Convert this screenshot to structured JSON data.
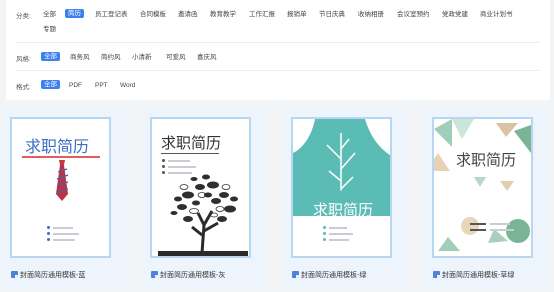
{
  "filters": {
    "category": {
      "label": "分类:",
      "options": [
        "全部",
        "简历",
        "员工登记表",
        "合同模板",
        "邀请函",
        "教育教学",
        "工作汇报",
        "报销单",
        "节日庆典",
        "收纳相册",
        "会议室预约",
        "党政党建",
        "商业计划书",
        "专题"
      ],
      "active": "简历"
    },
    "style": {
      "label": "风格:",
      "options": [
        "全部",
        "商务风",
        "简约风",
        "小清新",
        "可爱风",
        "喜庆风"
      ],
      "active": "全部"
    },
    "format": {
      "label": "格式:",
      "options": [
        "全部",
        "PDF",
        "PPT",
        "Word"
      ],
      "active": "全部"
    }
  },
  "templates": [
    {
      "name": "封面简历通用模板-蓝",
      "cover_text": "求职简历",
      "color": "#3a6fc4"
    },
    {
      "name": "封面简历通用模板-灰",
      "cover_text": "求职简历",
      "color": "#3a3a3a"
    },
    {
      "name": "封面简历通用模板-绿",
      "cover_text": "求职简历",
      "color": "#5bbcb5"
    },
    {
      "name": "封面简历通用模板-草绿",
      "cover_text": "求职简历",
      "color": "#7ab497"
    }
  ],
  "colors": {
    "accent": "#3b7ff0",
    "card_bg": "#eef4fb",
    "thumb_border": "#b6d6f2"
  }
}
